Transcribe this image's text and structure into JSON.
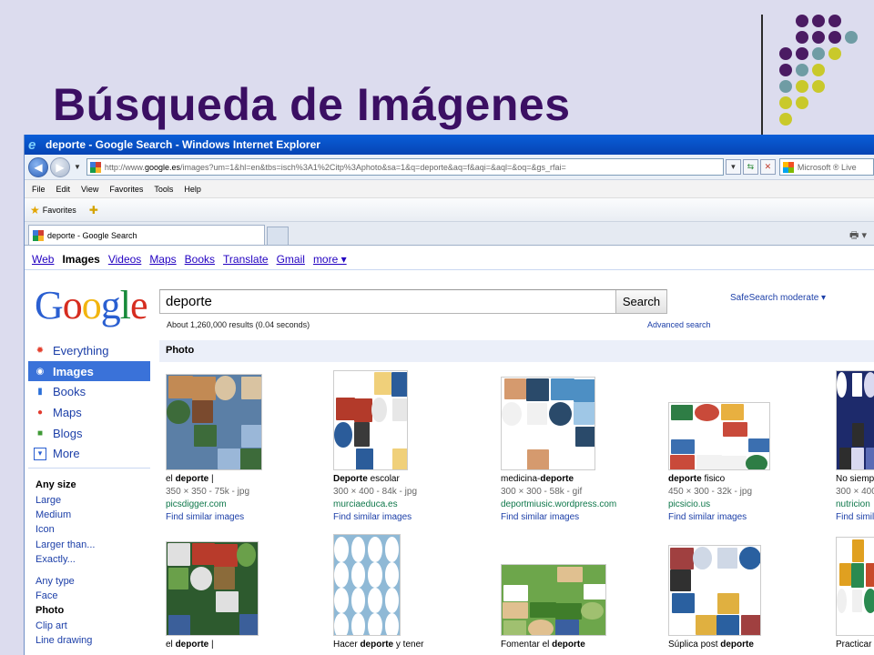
{
  "slide": {
    "title": "Búsqueda de Imágenes",
    "dot_colors": {
      "purple": "#4b1b63",
      "teal": "#6f9ca4",
      "yellow": "#c9c92b"
    }
  },
  "browser": {
    "title": "deporte - Google Search - Windows Internet Explorer",
    "address_prefix": "http://www.",
    "address_host": "google.es",
    "address_rest": "/images?um=1&hl=en&tbs=isch%3A1%2Citp%3Aphoto&sa=1&q=deporte&aq=f&aqi=&aql=&oq=&gs_rfai=",
    "search_provider": "Microsoft ® Live",
    "menu": [
      "File",
      "Edit",
      "View",
      "Favorites",
      "Tools",
      "Help"
    ],
    "favorites_label": "Favorites",
    "tab_title": "deporte - Google Search"
  },
  "google": {
    "nav": [
      "Web",
      "Images",
      "Videos",
      "Maps",
      "Books",
      "Translate",
      "Gmail",
      "more ▾"
    ],
    "nav_active": "Images",
    "logo_letters": [
      {
        "ch": "G",
        "color": "#2a5fd1"
      },
      {
        "ch": "o",
        "color": "#d62d20"
      },
      {
        "ch": "o",
        "color": "#f2b50f"
      },
      {
        "ch": "g",
        "color": "#2a5fd1"
      },
      {
        "ch": "l",
        "color": "#178a3a"
      },
      {
        "ch": "e",
        "color": "#d62d20"
      }
    ],
    "query": "deporte",
    "search_button": "Search",
    "safesearch": "SafeSearch moderate ▾",
    "results_stats": "About 1,260,000 results (0.04 seconds)",
    "advanced_search": "Advanced search",
    "left_nav": [
      {
        "label": "Everything",
        "icon": "everything-icon",
        "color": "#e4402e"
      },
      {
        "label": "Images",
        "icon": "camera-icon",
        "color": "#ffffff",
        "selected": true
      },
      {
        "label": "Books",
        "icon": "book-icon",
        "color": "#2a6fd8"
      },
      {
        "label": "Maps",
        "icon": "map-pin-icon",
        "color": "#e23b2e"
      },
      {
        "label": "Blogs",
        "icon": "blog-bubble-icon",
        "color": "#3f9a36"
      },
      {
        "label": "More",
        "icon": "chevron-down-icon",
        "color": "#2a5fd1"
      }
    ],
    "size_filters": [
      "Any size",
      "Large",
      "Medium",
      "Icon",
      "Larger than...",
      "Exactly..."
    ],
    "type_filters": [
      "Any type",
      "Face",
      "Photo",
      "Clip art",
      "Line drawing"
    ],
    "active_size": "Any size",
    "active_type": "Photo",
    "section_header": "Photo",
    "find_similar": "Find similar images",
    "results_row1": [
      {
        "caption_pre": "el ",
        "caption_bold": "deporte",
        "caption_post": " |",
        "meta": "350 × 350 - 75k - jpg",
        "site": "picsdigger.com"
      },
      {
        "caption_pre": "",
        "caption_bold": "Deporte",
        "caption_post": " escolar",
        "meta": "300 × 400 - 84k - jpg",
        "site": "murciaeduca.es"
      },
      {
        "caption_pre": "medicina-",
        "caption_bold": "deporte",
        "caption_post": "",
        "meta": "300 × 300 - 58k - gif",
        "site": "deportmiusic.wordpress.com"
      },
      {
        "caption_pre": "",
        "caption_bold": "deporte",
        "caption_post": " fisico",
        "meta": "450 × 300 - 32k - jpg",
        "site": "picsicio.us"
      },
      {
        "caption_pre": "No siemp",
        "caption_bold": "",
        "caption_post": "",
        "meta": "300 × 400",
        "site": "nutricion"
      }
    ],
    "results_row2": [
      {
        "caption_pre": "el ",
        "caption_bold": "deporte",
        "caption_post": " |"
      },
      {
        "caption_pre": "Hacer ",
        "caption_bold": "deporte",
        "caption_post": " y tener"
      },
      {
        "caption_pre": "Fomentar el ",
        "caption_bold": "deporte",
        "caption_post": ""
      },
      {
        "caption_pre": "Súplica post ",
        "caption_bold": "deporte",
        "caption_post": ""
      },
      {
        "caption_pre": "Practicar",
        "caption_bold": "",
        "caption_post": ""
      }
    ]
  }
}
